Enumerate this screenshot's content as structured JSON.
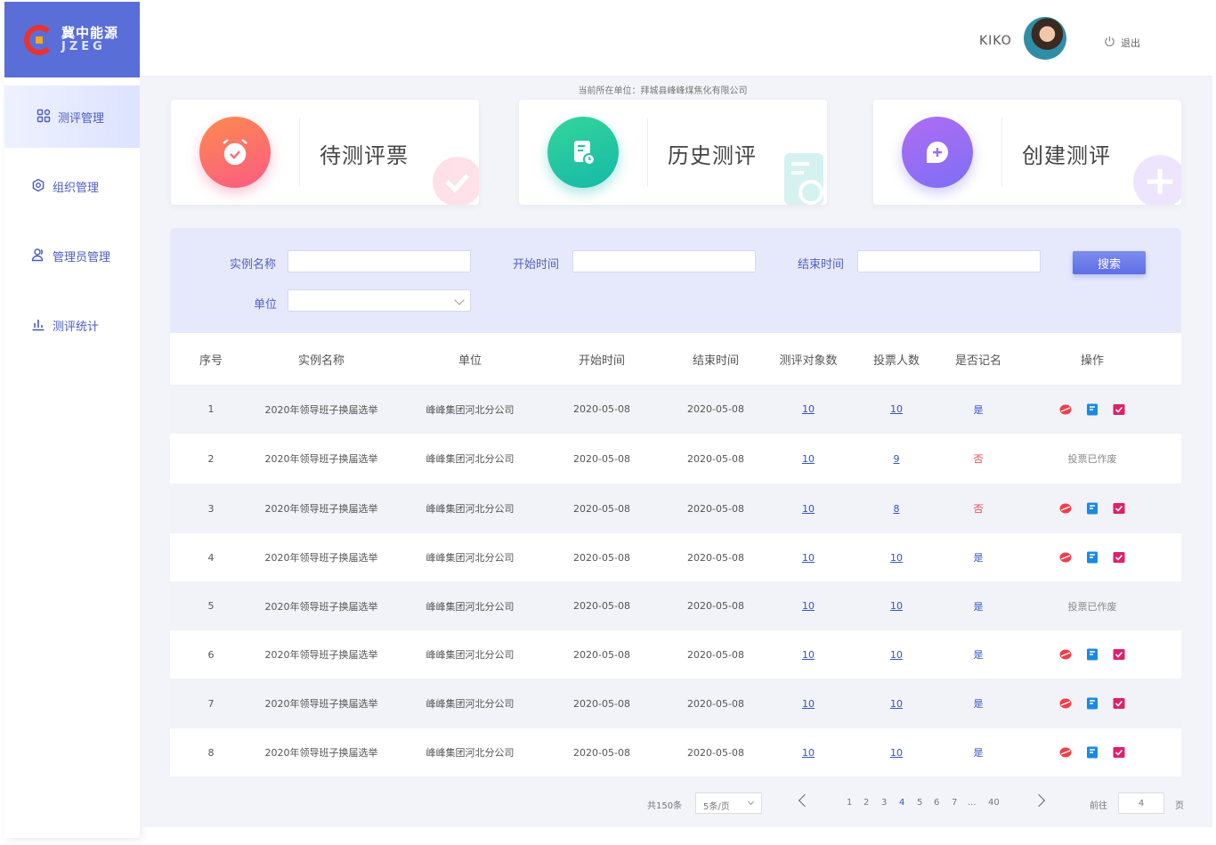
{
  "brand": {
    "name_cn": "冀中能源",
    "name_en": "JZEG"
  },
  "sidebar": {
    "items": [
      {
        "label": "测评管理",
        "icon": "grid-icon"
      },
      {
        "label": "组织管理",
        "icon": "gear-icon"
      },
      {
        "label": "管理员管理",
        "icon": "users-icon"
      },
      {
        "label": "测评统计",
        "icon": "bar-chart-icon"
      }
    ]
  },
  "header": {
    "user_name": "KIKO",
    "logout_label": "退出"
  },
  "current_unit": "当前所在单位：拜城县峰峰煤焦化有限公司",
  "cards": [
    {
      "label": "待测评票",
      "icon": "alarm-clock-icon",
      "colors": [
        "#fd8a4e",
        "#fb5b84"
      ]
    },
    {
      "label": "历史测评",
      "icon": "document-clock-icon",
      "colors": [
        "#34d59a",
        "#16b9a9"
      ]
    },
    {
      "label": "创建测评",
      "icon": "chat-plus-icon",
      "colors": [
        "#b06cf4",
        "#7d6ff5"
      ]
    }
  ],
  "search": {
    "instance_name_label": "实例名称",
    "start_time_label": "开始时间",
    "end_time_label": "结束时间",
    "unit_label": "单位",
    "instance_name_value": "",
    "start_time_value": "",
    "end_time_value": "",
    "unit_value": "",
    "button_label": "搜索"
  },
  "table": {
    "columns": [
      "序号",
      "实例名称",
      "单位",
      "开始时间",
      "结束时间",
      "测评对象数",
      "投票人数",
      "是否记名",
      "操作"
    ],
    "rows": [
      {
        "no": "1",
        "name": "2020年领导班子换届选举",
        "unit": "峰峰集团河北分公司",
        "start": "2020-05-08",
        "end": "2020-05-08",
        "objects": "10",
        "voters": "10",
        "named": "是",
        "status": ""
      },
      {
        "no": "2",
        "name": "2020年领导班子换届选举",
        "unit": "峰峰集团河北分公司",
        "start": "2020-05-08",
        "end": "2020-05-08",
        "objects": "10",
        "voters": "9",
        "named": "否",
        "status": "投票已作废"
      },
      {
        "no": "3",
        "name": "2020年领导班子换届选举",
        "unit": "峰峰集团河北分公司",
        "start": "2020-05-08",
        "end": "2020-05-08",
        "objects": "10",
        "voters": "8",
        "named": "否",
        "status": ""
      },
      {
        "no": "4",
        "name": "2020年领导班子换届选举",
        "unit": "峰峰集团河北分公司",
        "start": "2020-05-08",
        "end": "2020-05-08",
        "objects": "10",
        "voters": "10",
        "named": "是",
        "status": ""
      },
      {
        "no": "5",
        "name": "2020年领导班子换届选举",
        "unit": "峰峰集团河北分公司",
        "start": "2020-05-08",
        "end": "2020-05-08",
        "objects": "10",
        "voters": "10",
        "named": "是",
        "status": "投票已作废"
      },
      {
        "no": "6",
        "name": "2020年领导班子换届选举",
        "unit": "峰峰集团河北分公司",
        "start": "2020-05-08",
        "end": "2020-05-08",
        "objects": "10",
        "voters": "10",
        "named": "是",
        "status": ""
      },
      {
        "no": "7",
        "name": "2020年领导班子换届选举",
        "unit": "峰峰集团河北分公司",
        "start": "2020-05-08",
        "end": "2020-05-08",
        "objects": "10",
        "voters": "10",
        "named": "是",
        "status": ""
      },
      {
        "no": "8",
        "name": "2020年领导班子换届选举",
        "unit": "峰峰集团河北分公司",
        "start": "2020-05-08",
        "end": "2020-05-08",
        "objects": "10",
        "voters": "10",
        "named": "是",
        "status": ""
      }
    ]
  },
  "pagination": {
    "total_label": "共150条",
    "page_size": "5条/页",
    "pages": [
      "1",
      "2",
      "3",
      "4",
      "5",
      "6",
      "7",
      "...",
      "40"
    ],
    "current_page": "4",
    "goto_label": "前往",
    "goto_value": "4",
    "page_word": "页"
  },
  "colors": {
    "accent": "#5a6ed8",
    "link": "#3451c9",
    "no": "#e8454a"
  }
}
